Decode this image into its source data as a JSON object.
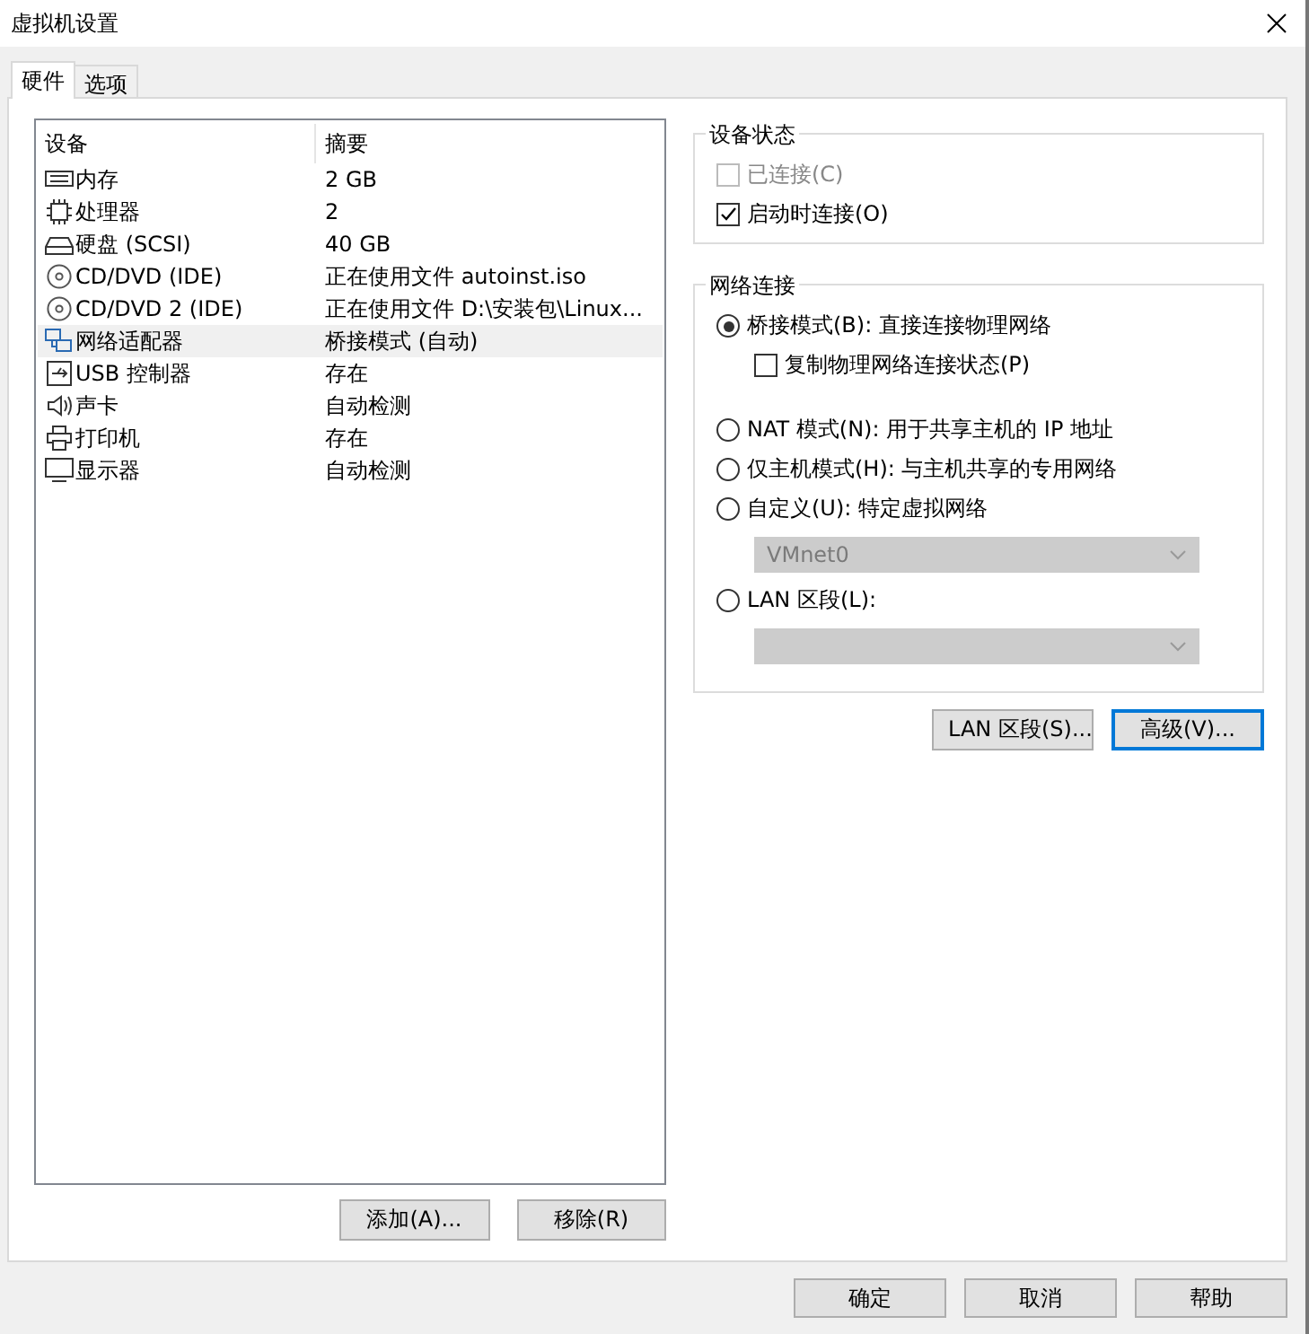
{
  "window": {
    "title": "虚拟机设置"
  },
  "tabs": [
    {
      "label": "硬件",
      "selected": true
    },
    {
      "label": "选项",
      "selected": false
    }
  ],
  "devices": {
    "columns": [
      "设备",
      "摘要"
    ],
    "rows": [
      {
        "kind": "memory",
        "name": "内存",
        "summary": "2 GB",
        "selected": false
      },
      {
        "kind": "cpu",
        "name": "处理器",
        "summary": "2",
        "selected": false
      },
      {
        "kind": "disk",
        "name": "硬盘 (SCSI)",
        "summary": "40 GB",
        "selected": false
      },
      {
        "kind": "cd",
        "name": "CD/DVD (IDE)",
        "summary": "正在使用文件 autoinst.iso",
        "selected": false
      },
      {
        "kind": "cd",
        "name": "CD/DVD 2 (IDE)",
        "summary": "正在使用文件 D:\\安装包\\Linux...",
        "selected": false
      },
      {
        "kind": "network",
        "name": "网络适配器",
        "summary": "桥接模式 (自动)",
        "selected": true
      },
      {
        "kind": "usb",
        "name": "USB 控制器",
        "summary": "存在",
        "selected": false
      },
      {
        "kind": "sound",
        "name": "声卡",
        "summary": "自动检测",
        "selected": false
      },
      {
        "kind": "printer",
        "name": "打印机",
        "summary": "存在",
        "selected": false
      },
      {
        "kind": "display",
        "name": "显示器",
        "summary": "自动检测",
        "selected": false
      }
    ],
    "buttons": [
      "添加(A)...",
      "移除(R)"
    ]
  },
  "device_status": {
    "title": "设备状态",
    "checkboxes": [
      {
        "label": "已连接(C)",
        "checked": false,
        "disabled": true
      },
      {
        "label": "启动时连接(O)",
        "checked": true,
        "disabled": false
      }
    ]
  },
  "network": {
    "title": "网络连接",
    "options": [
      {
        "label": "桥接模式(B): 直接连接物理网络",
        "selected": true,
        "checkbox": {
          "label": "复制物理网络连接状态(P)",
          "checked": false
        }
      },
      {
        "label": "NAT 模式(N): 用于共享主机的 IP 地址",
        "selected": false
      },
      {
        "label": "仅主机模式(H): 与主机共享的专用网络",
        "selected": false
      },
      {
        "label": "自定义(U): 特定虚拟网络",
        "selected": false,
        "select": {
          "value": "VMnet0",
          "disabled": true
        }
      },
      {
        "label": "LAN 区段(L):",
        "selected": false,
        "select": {
          "disabled": true
        }
      }
    ],
    "buttons": [
      {
        "label": "LAN 区段(S)...",
        "default": false
      },
      {
        "label": "高级(V)...",
        "default": true
      }
    ]
  },
  "dialog_buttons": [
    "确定",
    "取消",
    "帮助"
  ]
}
